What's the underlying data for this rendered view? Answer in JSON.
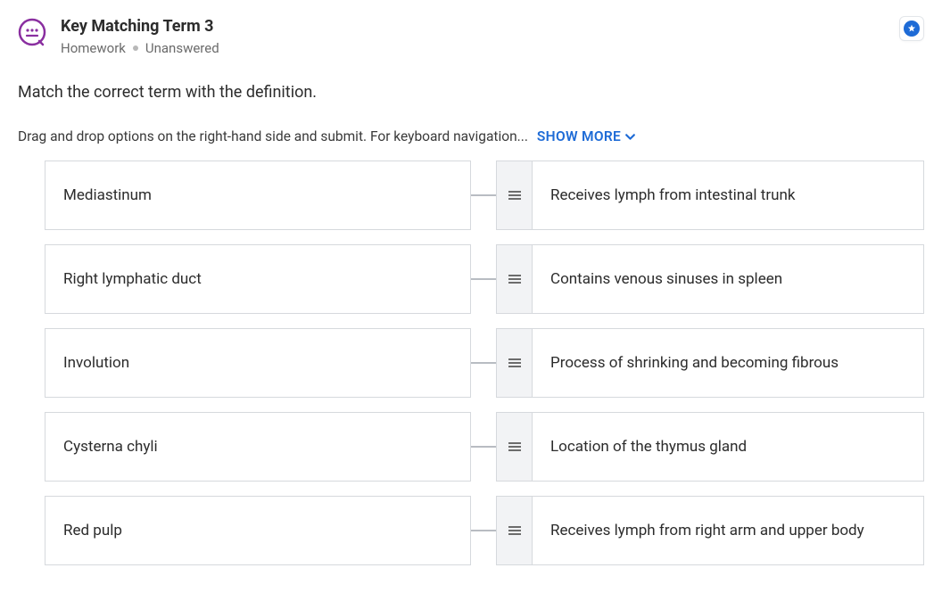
{
  "header": {
    "title": "Key Matching Term 3",
    "category": "Homework",
    "status": "Unanswered"
  },
  "prompt": "Match the correct term with the definition.",
  "instruction": "Drag and drop options on the right-hand side and submit. For keyboard navigation...",
  "show_more_label": "SHOW MORE",
  "pairs": [
    {
      "term": "Mediastinum",
      "answer": "Receives lymph from intestinal trunk"
    },
    {
      "term": "Right lymphatic duct",
      "answer": "Contains venous sinuses in spleen"
    },
    {
      "term": "Involution",
      "answer": "Process of shrinking and becoming fibrous"
    },
    {
      "term": "Cysterna chyli",
      "answer": "Location of the thymus gland"
    },
    {
      "term": "Red pulp",
      "answer": "Receives lymph from right arm and upper body"
    }
  ]
}
